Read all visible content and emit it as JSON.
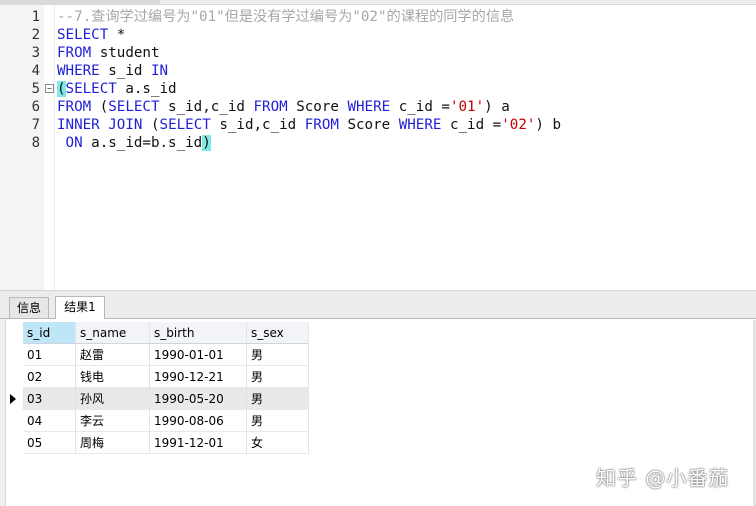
{
  "editor": {
    "lines": [
      {
        "num": "1",
        "tokens": [
          {
            "t": "--7.查询学过编号为\"01\"但是没有学过编号为\"02\"的课程的同学的信息",
            "c": "cm"
          }
        ]
      },
      {
        "num": "2",
        "tokens": [
          {
            "t": "SELECT",
            "c": "kw"
          },
          {
            "t": " *",
            "c": ""
          }
        ]
      },
      {
        "num": "3",
        "tokens": [
          {
            "t": "FROM",
            "c": "kw"
          },
          {
            "t": " student",
            "c": ""
          }
        ]
      },
      {
        "num": "4",
        "tokens": [
          {
            "t": "WHERE",
            "c": "kw"
          },
          {
            "t": " s_id ",
            "c": ""
          },
          {
            "t": "IN",
            "c": "kw"
          }
        ]
      },
      {
        "num": "5",
        "fold": "−",
        "tokens": [
          {
            "t": "(",
            "c": "hl"
          },
          {
            "t": "SELECT",
            "c": "kw"
          },
          {
            "t": " a.s_id",
            "c": ""
          }
        ]
      },
      {
        "num": "6",
        "tokens": [
          {
            "t": "FROM",
            "c": "kw"
          },
          {
            "t": " (",
            "c": ""
          },
          {
            "t": "SELECT",
            "c": "kw"
          },
          {
            "t": " s_id,c_id ",
            "c": ""
          },
          {
            "t": "FROM",
            "c": "kw"
          },
          {
            "t": " Score ",
            "c": ""
          },
          {
            "t": "WHERE",
            "c": "kw"
          },
          {
            "t": " c_id =",
            "c": ""
          },
          {
            "t": "'01'",
            "c": "str"
          },
          {
            "t": ") a",
            "c": ""
          }
        ]
      },
      {
        "num": "7",
        "tokens": [
          {
            "t": "INNER",
            "c": "kw"
          },
          {
            "t": " ",
            "c": ""
          },
          {
            "t": "JOIN",
            "c": "kw"
          },
          {
            "t": " (",
            "c": ""
          },
          {
            "t": "SELECT",
            "c": "kw"
          },
          {
            "t": " s_id,c_id ",
            "c": ""
          },
          {
            "t": "FROM",
            "c": "kw"
          },
          {
            "t": " Score ",
            "c": ""
          },
          {
            "t": "WHERE",
            "c": "kw"
          },
          {
            "t": " c_id =",
            "c": ""
          },
          {
            "t": "'02'",
            "c": "str"
          },
          {
            "t": ") b",
            "c": ""
          }
        ]
      },
      {
        "num": "8",
        "tokens": [
          {
            "t": " ",
            "c": ""
          },
          {
            "t": "ON",
            "c": "kw"
          },
          {
            "t": " a.s_id=b.s_id",
            "c": ""
          },
          {
            "t": ")",
            "c": "hl"
          }
        ]
      }
    ]
  },
  "tabs": {
    "info_label": "信息",
    "result_label": "结果1"
  },
  "results": {
    "columns": [
      "s_id",
      "s_name",
      "s_birth",
      "s_sex"
    ],
    "rows": [
      [
        "01",
        "赵雷",
        "1990-01-01",
        "男"
      ],
      [
        "02",
        "钱电",
        "1990-12-21",
        "男"
      ],
      [
        "03",
        "孙风",
        "1990-05-20",
        "男"
      ],
      [
        "04",
        "李云",
        "1990-08-06",
        "男"
      ],
      [
        "05",
        "周梅",
        "1991-12-01",
        "女"
      ]
    ],
    "selected_row": 2,
    "active_column": 0
  },
  "watermark": "知乎 @小番茄",
  "colors": {
    "keyword": "#1f1fd6",
    "comment": "#a7a7a7",
    "string": "#c20000",
    "bracket_highlight": "#7fe8e8",
    "header_active": "#bfe6f7"
  }
}
